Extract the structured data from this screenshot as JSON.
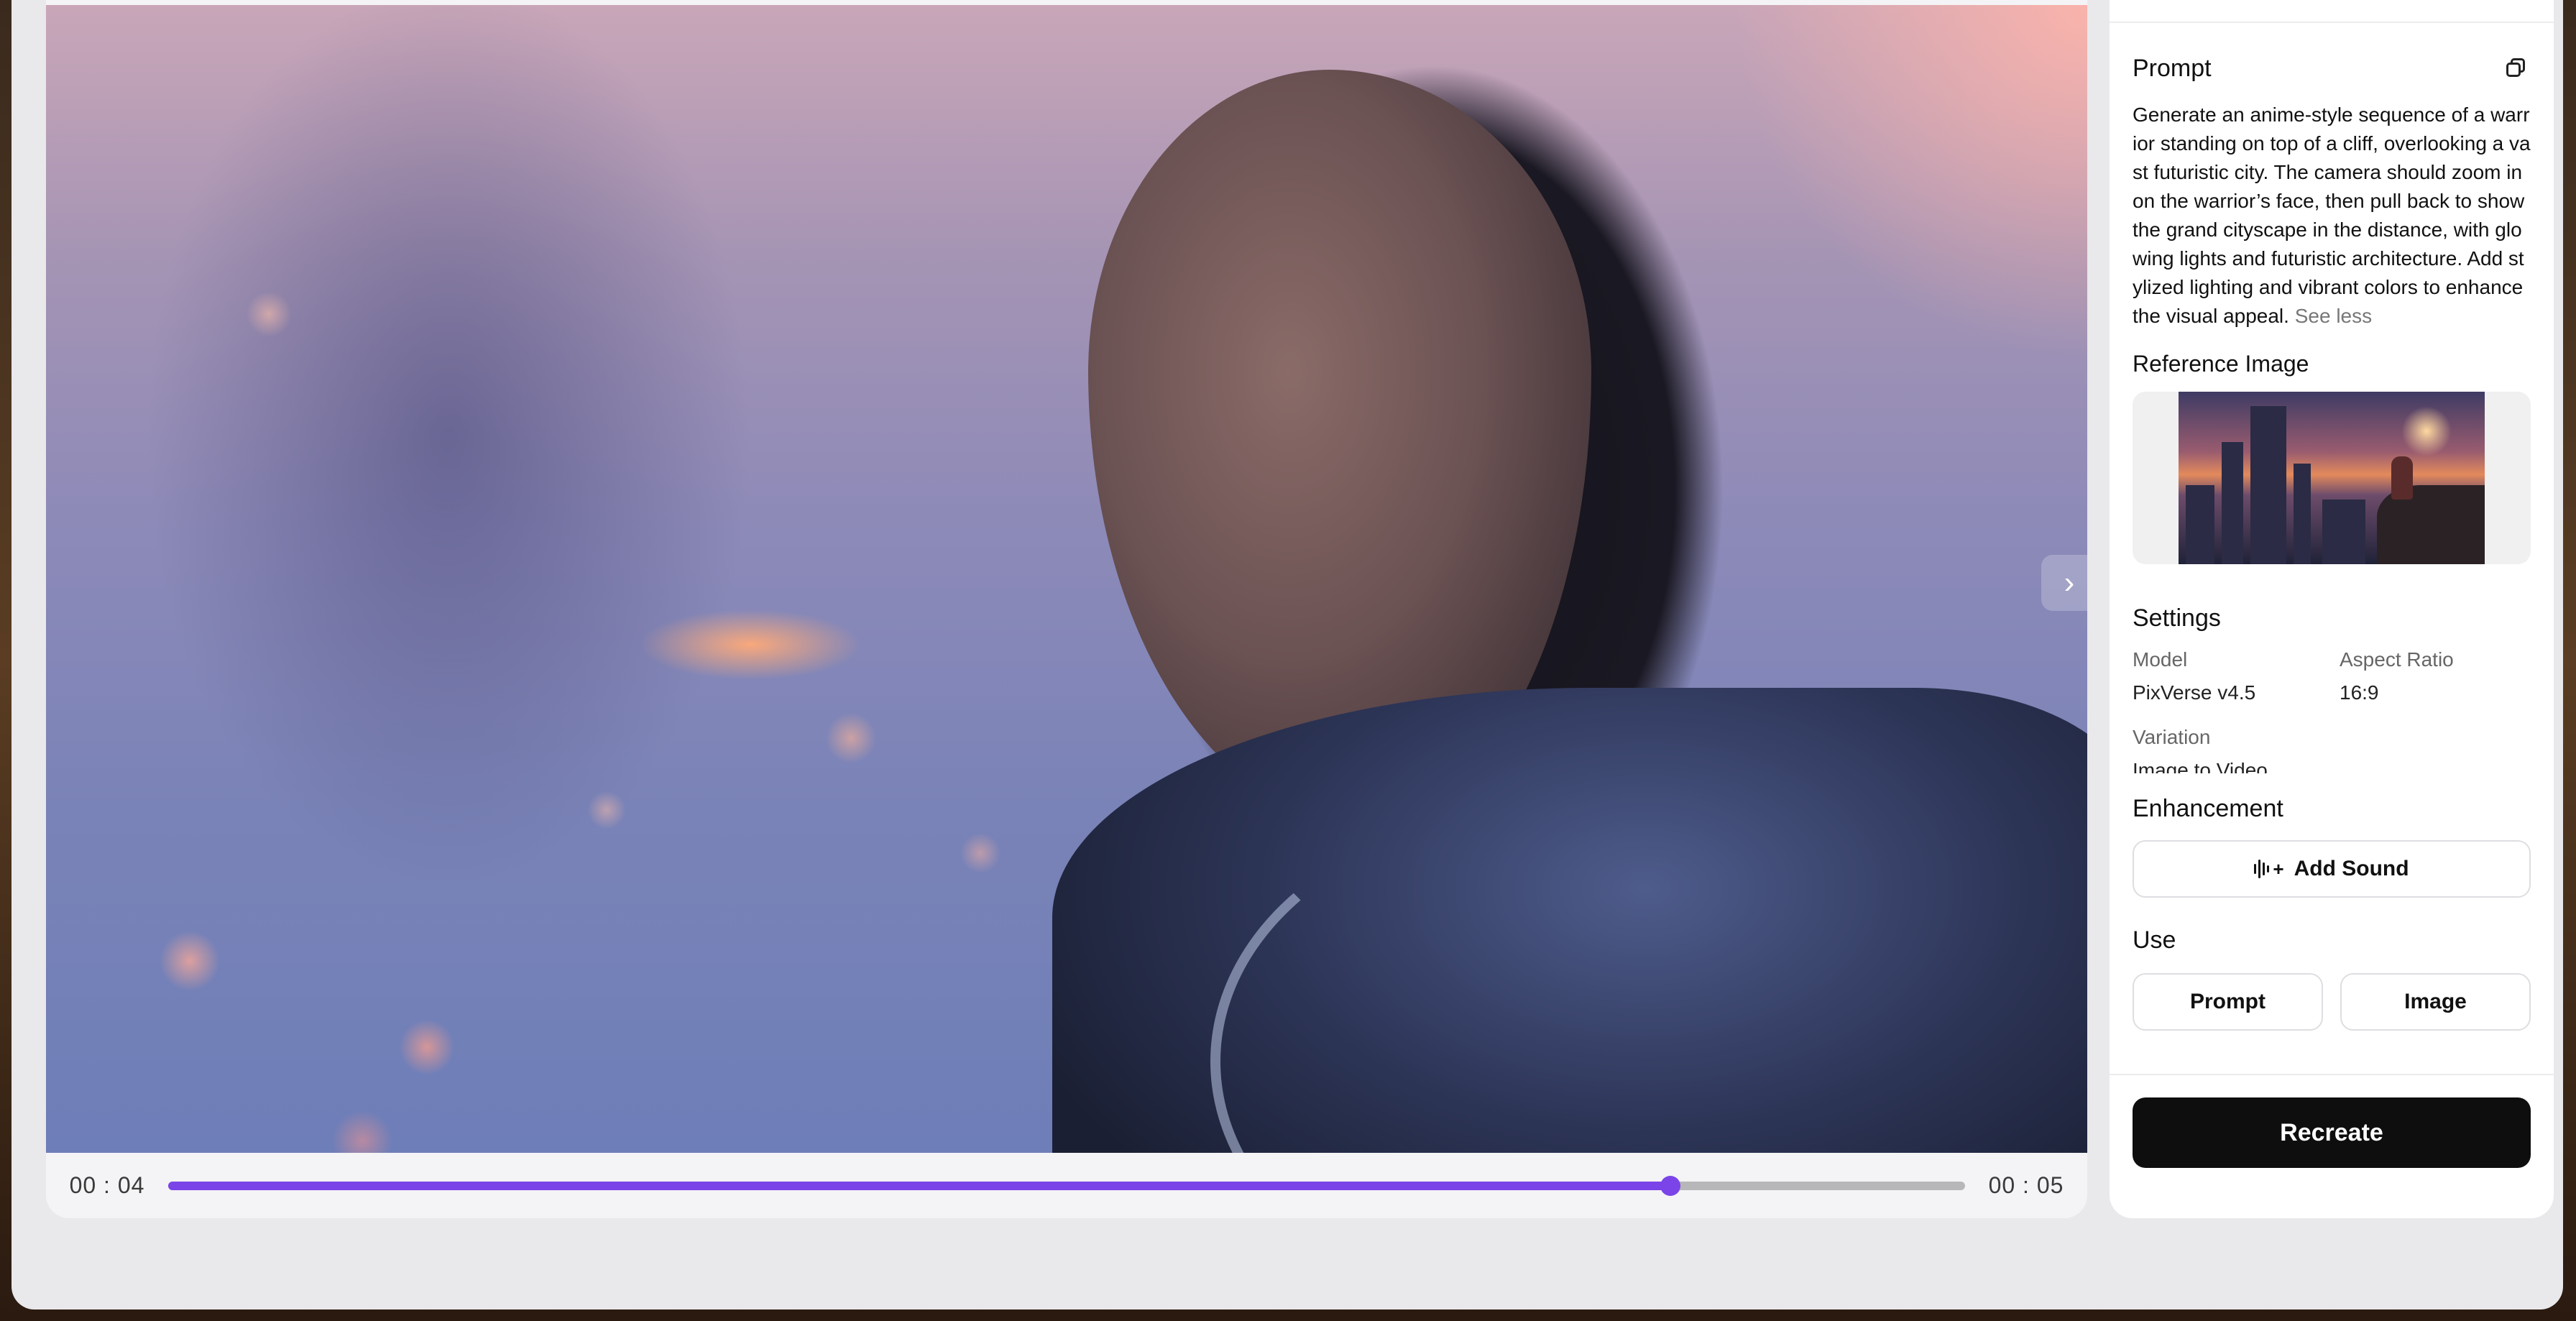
{
  "player": {
    "current_time": "00 : 04",
    "duration": "00 : 05",
    "progress_fraction": 0.836
  },
  "prompt": {
    "title": "Prompt",
    "text": "Generate an anime-style sequence of a warrior standing on top of a cliff, overlooking a vast futuristic city. The camera should zoom in on the warrior’s face, then pull back to show the grand cityscape in the distance, with glowing lights and futuristic architecture. Add stylized lighting and vibrant colors to enhance the visual appeal.",
    "see_less": "See less"
  },
  "reference": {
    "title": "Reference Image"
  },
  "settings": {
    "title": "Settings",
    "model_label": "Model",
    "model_value": "PixVerse v4.5",
    "aspect_label": "Aspect Ratio",
    "aspect_value": "16:9",
    "variation_label": "Variation",
    "variation_value": "Image to Video"
  },
  "enhancement": {
    "title": "Enhancement",
    "add_sound_label": "Add Sound"
  },
  "use": {
    "title": "Use",
    "prompt_label": "Prompt",
    "image_label": "Image"
  },
  "actions": {
    "recreate_label": "Recreate"
  },
  "colors": {
    "accent": "#7b44e8",
    "primary_button": "#0e0e0f"
  }
}
